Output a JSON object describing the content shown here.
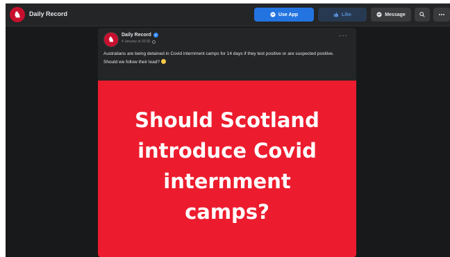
{
  "app": {
    "page_name": "Daily Record",
    "logo_glyph": "♞",
    "brand_color": "#c8102e"
  },
  "topbar": {
    "use_app_label": "Use App",
    "like_label": "Like",
    "message_label": "Message",
    "icons": [
      "messenger-icon",
      "thumbs-up-icon",
      "search-icon",
      "more-icon"
    ]
  },
  "post": {
    "author": "Daily Record",
    "timestamp": "4 January at 20:30",
    "text_line_1": "Australians are being detained in Covid internment camps for 14 days if they test positive or are suspected positive.",
    "text_line_2": "Should we follow their lead?",
    "menu_glyph": "···",
    "image": {
      "background_color": "#ec1c2e",
      "headline_lines": [
        "Should Scotland",
        "introduce Covid",
        "internment",
        "camps?"
      ]
    }
  }
}
